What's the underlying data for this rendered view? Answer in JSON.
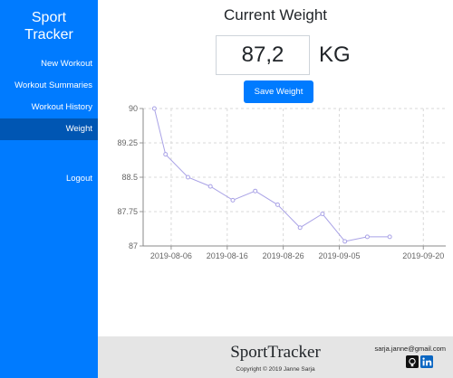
{
  "sidebar": {
    "brand_line1": "Sport",
    "brand_line2": "Tracker",
    "items": [
      {
        "label": "New Workout"
      },
      {
        "label": "Workout Summaries"
      },
      {
        "label": "Workout History"
      },
      {
        "label": "Weight"
      }
    ],
    "active": "Weight",
    "logout": "Logout",
    "color": "#007bff",
    "active_color": "#0056b3"
  },
  "main": {
    "title": "Current Weight",
    "weight_value": "87,2",
    "unit": "KG",
    "save_label": "Save Weight"
  },
  "chart_data": {
    "type": "line",
    "x": [
      "2019-08-03",
      "2019-08-05",
      "2019-08-09",
      "2019-08-13",
      "2019-08-17",
      "2019-08-21",
      "2019-08-25",
      "2019-08-29",
      "2019-09-02",
      "2019-09-06",
      "2019-09-10",
      "2019-09-14"
    ],
    "values": [
      90,
      89,
      88.5,
      88.3,
      88,
      88.2,
      87.9,
      87.4,
      87.7,
      87.1,
      87.2,
      87.2
    ],
    "x_tick_labels": [
      "2019-08-06",
      "2019-08-16",
      "2019-08-26",
      "2019-09-05",
      "2019-09-20"
    ],
    "x_tick_dates": [
      "2019-08-06",
      "2019-08-16",
      "2019-08-26",
      "2019-09-05",
      "2019-09-20"
    ],
    "y_tick_labels": [
      "90",
      "89.25",
      "88.5",
      "87.75",
      "87"
    ],
    "ylim": [
      87,
      90
    ],
    "xlim": [
      "2019-08-01",
      "2019-09-24"
    ],
    "grid": true,
    "line_color": "#a9a2e6"
  },
  "footer": {
    "brand": "SportTracker",
    "copyright": "Copyright © 2019 Janne Sarja",
    "email": "sarja.janne@gmail.com",
    "icons": [
      "github-icon",
      "linkedin-icon"
    ]
  }
}
